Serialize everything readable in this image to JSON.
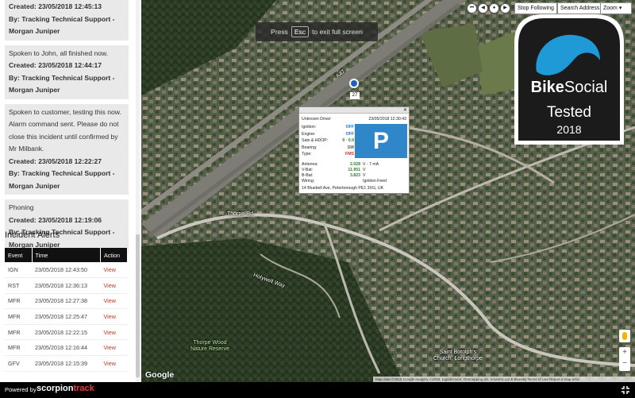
{
  "notes": [
    {
      "created": "Created: 23/05/2018 12:45:13",
      "by": "By: Tracking Technical Support - Morgan Juniper"
    },
    {
      "text": "Spoken to John, all finished now.",
      "created": "Created: 23/05/2018 12:44:17",
      "by": "By: Tracking Technical Support - Morgan Juniper"
    },
    {
      "text": "Spoken to customer, testing this now. Alarm command sent. Please do not close this incident until confirmed by Mr Milbank.",
      "created": "Created: 23/05/2018 12:22:27",
      "by": "By: Tracking Technical Support - Morgan Juniper"
    },
    {
      "text": "Phoning",
      "created": "Created: 23/05/2018 12:19:06",
      "by": "By: Tracking Technical Support - Morgan Juniper"
    }
  ],
  "alerts": {
    "title": "Incident Alerts",
    "headers": [
      "Event",
      "Time",
      "Action"
    ],
    "rows": [
      {
        "event": "IGN",
        "time": "23/05/2018 12:43:50",
        "action": "View"
      },
      {
        "event": "RST",
        "time": "23/05/2018 12:36:13",
        "action": "View"
      },
      {
        "event": "MFR",
        "time": "23/05/2018 12:27:38",
        "action": "View"
      },
      {
        "event": "MFR",
        "time": "23/05/2018 12:25:47",
        "action": "View"
      },
      {
        "event": "MFR",
        "time": "23/05/2018 12:22:15",
        "action": "View"
      },
      {
        "event": "MFR",
        "time": "23/05/2018 12:16:44",
        "action": "View"
      },
      {
        "event": "GFV",
        "time": "23/05/2018 12:15:39",
        "action": "View"
      }
    ]
  },
  "map": {
    "esc_prefix": "Press",
    "esc_key": "Esc",
    "esc_suffix": "to exit full screen",
    "stop_following": "Stop Following",
    "search_address": "Search Address",
    "zoom": "Zoom",
    "google": "Google",
    "attribution": "Map data ©2018 Google Imagery ©2018, DigitalGlobe, Getmapping plc, Infoterra Ltd & Bluesky   Terms of Use   Report a map error",
    "marker_label": "27",
    "labels": {
      "thorpe_rd": "Thorpe Rd",
      "thorpe_wood": "Thorpe Wood\nNature Reserve",
      "st_botolph": "Saint Botolph's\nChurch, Longthorpe",
      "holywell": "Holywell Way",
      "a47": "A47"
    }
  },
  "popup": {
    "driver": "Unknown Driver",
    "timestamp": "23/05/2018 12:30:43",
    "rows": [
      {
        "label": "Ignition:",
        "value": "OFF",
        "color": "#1a73e8"
      },
      {
        "label": "Engine:",
        "value": "OFF",
        "color": "#1a73e8"
      },
      {
        "label": "Sats & HDOP:",
        "value": "9 · 0.9",
        "color": "#2e7d32"
      },
      {
        "label": "Bearing:",
        "value": "SW",
        "color": "#555555"
      },
      {
        "label": "Type:",
        "value": "FMS",
        "color": "#d32f2f"
      }
    ],
    "parking_letter": "P",
    "antenna": [
      {
        "label": "Antenna:",
        "value": "2.028",
        "unit": "V - 7 mA"
      },
      {
        "label": "V-Bat:",
        "value": "11.951",
        "unit": "V"
      },
      {
        "label": "B-Bat:",
        "value": "3.823",
        "unit": "V"
      },
      {
        "label": "Wiring:",
        "value": "",
        "unit": "Ignition Feed"
      }
    ],
    "address": "14 Bluebell Ave, Peterborough PE1 3XG, UK"
  },
  "badge": {
    "brand_a": "Bike",
    "brand_b": "Social",
    "tested": "Tested",
    "year": "2018",
    "accent": "#1f9ad6"
  },
  "footer": {
    "powered": "Powered by",
    "brand_a": "scorpion",
    "brand_b": "track"
  }
}
